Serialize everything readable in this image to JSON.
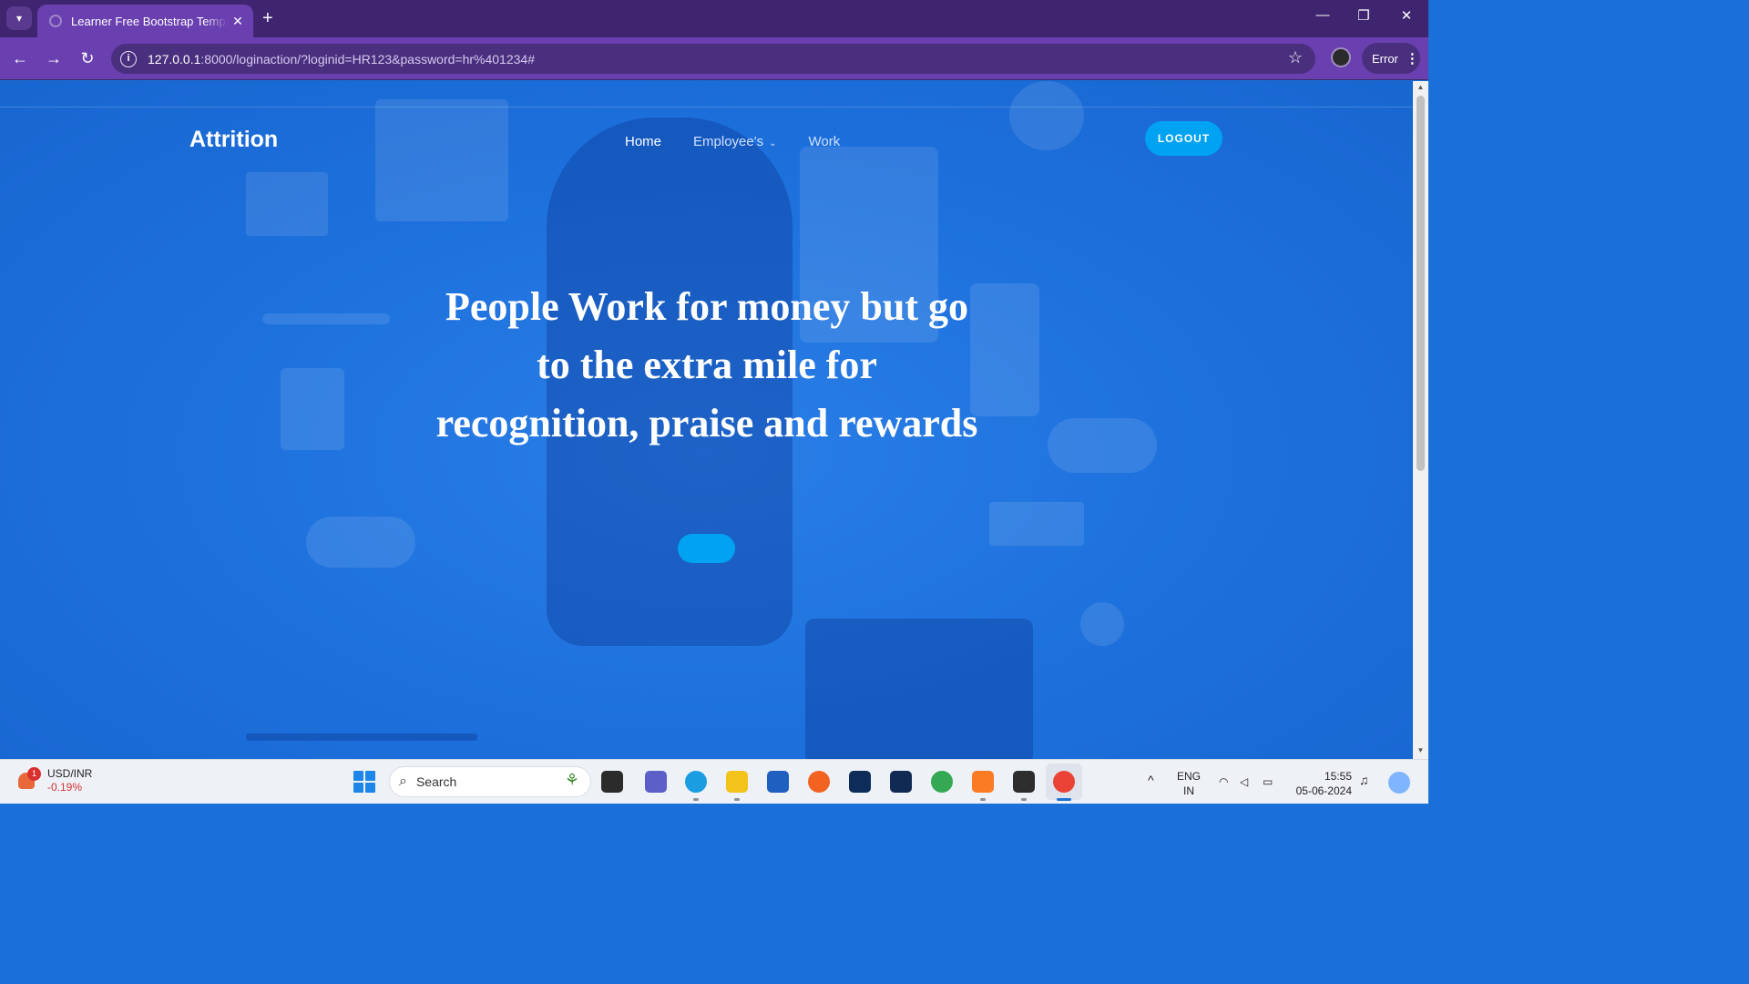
{
  "browser": {
    "tab_title": "Learner Free Bootstrap Template",
    "tab_close": "✕",
    "new_tab": "+",
    "url_host": "127.0.0.1",
    "url_path": ":8000/loginaction/?loginid=HR123&password=hr%401234#",
    "error_label": "Error",
    "minimize": "—",
    "restore": "❐",
    "close": "✕"
  },
  "site": {
    "brand": "Attrition",
    "nav": [
      {
        "label": "Home",
        "active": true
      },
      {
        "label": "Employee's",
        "dropdown": true
      },
      {
        "label": "Work"
      }
    ],
    "logout_label": "LOGOUT",
    "hero_heading": "People Work for money but go to the extra mile for recognition, praise and rewards",
    "hero_button_label": ""
  },
  "taskbar": {
    "ticker_pair": "USD/INR",
    "ticker_change": "-0.19%",
    "ticker_badge": "1",
    "search_placeholder": "Search",
    "lang_top": "ENG",
    "lang_bottom": "IN",
    "time": "15:55",
    "date": "05-06-2024"
  },
  "colors": {
    "tabbar": "#3f2470",
    "toolbar": "#6a3fb0",
    "page_bg": "#1d70dc",
    "accent_button": "#00a2f2"
  }
}
